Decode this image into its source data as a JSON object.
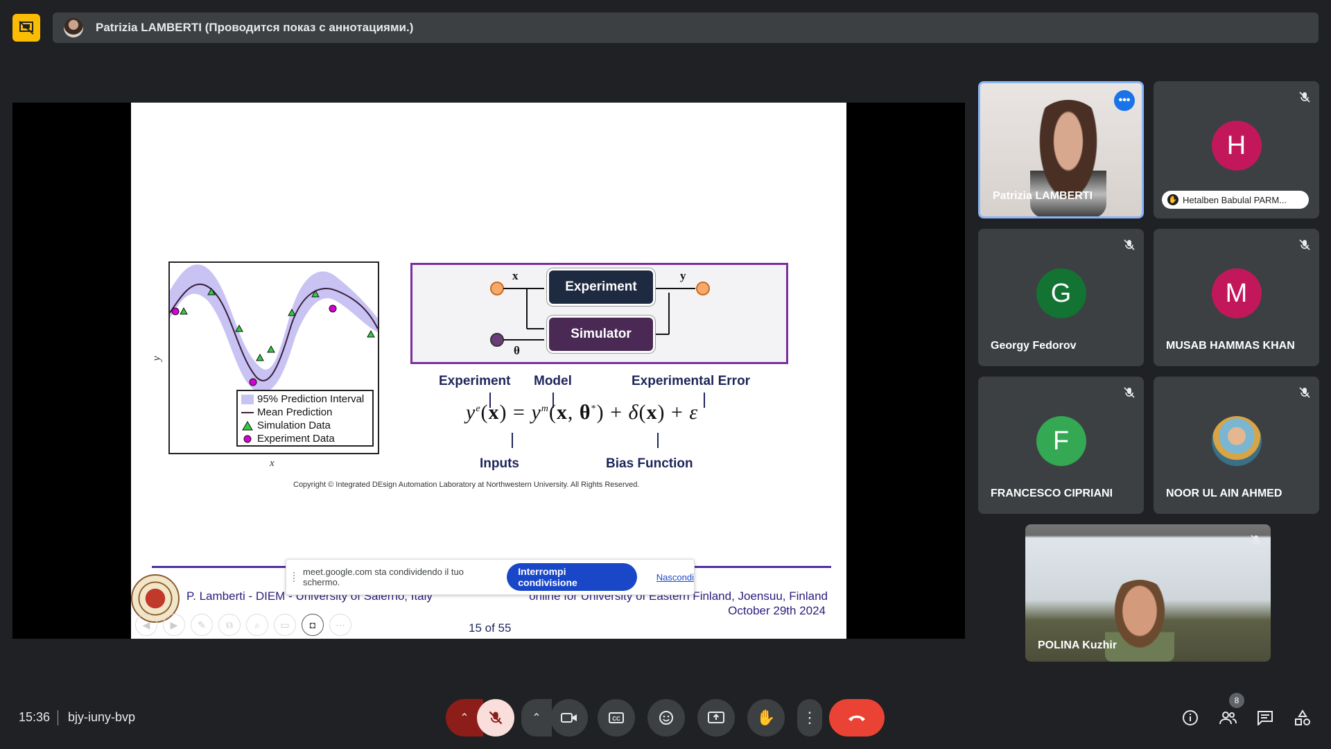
{
  "header": {
    "presenter_title": "Patrizia LAMBERTI (Проводится показ с аннотациями.)"
  },
  "slide": {
    "plot": {
      "ylabel": "y",
      "xlabel": "x",
      "legend": [
        {
          "label": "95% Prediction Interval",
          "symbol": "band",
          "color": "#c8c3f2"
        },
        {
          "label": "Mean Prediction",
          "symbol": "line",
          "color": "#3a1d3d"
        },
        {
          "label": "Simulation Data",
          "symbol": "triangle",
          "color": "#2ecc40"
        },
        {
          "label": "Experiment Data",
          "symbol": "circle",
          "color": "#d400d4"
        }
      ]
    },
    "diagram": {
      "experiment_label": "Experiment",
      "simulator_label": "Simulator",
      "input_label": "x",
      "output_label": "y",
      "theta_label": "θ"
    },
    "equation_labels": {
      "experiment": "Experiment",
      "model": "Model",
      "experimental_error": "Experimental Error",
      "inputs": "Inputs",
      "bias_function": "Bias Function"
    },
    "copyright": "Copyright © Integrated DEsign Automation Laboratory at Northwestern University. All Rights Reserved.",
    "footer_left": "P. Lamberti - DIEM - University of Salerno, Italy",
    "footer_right_line1": "online for University of Eastern Finland, Joensuu, Finland",
    "footer_right_line2": "October 29th 2024",
    "page_indicator": "15 of 55"
  },
  "share_banner": {
    "text": "meet.google.com sta condividendo il tuo schermo.",
    "stop_label": "Interrompi condivisione",
    "hide_label": "Nascondi"
  },
  "participants": [
    {
      "name": "Patrizia LAMBERTI"
    },
    {
      "initial": "H",
      "hand_label": "Hetalben Babulal PARM...",
      "color": "#c2185b"
    },
    {
      "initial": "G",
      "name": "Georgy Fedorov",
      "color": "#137333"
    },
    {
      "initial": "M",
      "name": "MUSAB HAMMAS KHAN",
      "color": "#c2185b"
    },
    {
      "initial": "F",
      "name": "FRANCESCO CIPRIANI",
      "color": "#34a853"
    },
    {
      "name": "NOOR UL AIN AHMED"
    },
    {
      "name": "POLINA Kuzhir"
    }
  ],
  "bottom_bar": {
    "time": "15:36",
    "meeting_code": "bjy-iuny-bvp",
    "people_count": "8"
  }
}
